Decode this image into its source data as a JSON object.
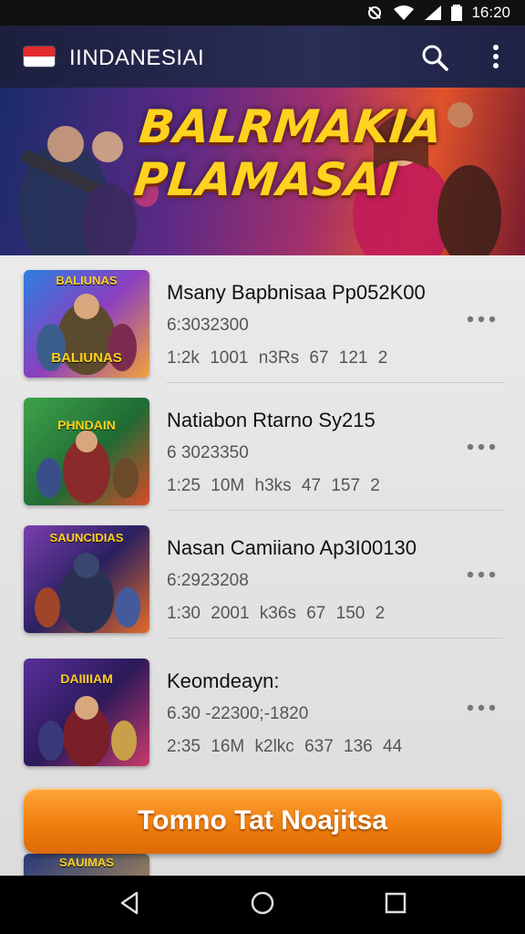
{
  "status_bar": {
    "time": "16:20",
    "icons": [
      "wifi-icon",
      "signal-icon",
      "battery-icon"
    ]
  },
  "app_bar": {
    "title": "IINDANESIAI",
    "flag_colors": [
      "#e32b2b",
      "#ffffff"
    ],
    "actions": [
      "search-icon",
      "more-vertical-icon"
    ]
  },
  "banner": {
    "title_line1": "BALRMAKIA",
    "title_line2": "PLAMASAI"
  },
  "games": [
    {
      "title": "Msany Bapbnisaa Pp052K00",
      "subtitle": "6:3032300",
      "stats": "1:2k 1001 n3Rs 67 121 2",
      "thumb_label": "BALIUNAS",
      "thumb_colors": [
        "#2c7fe0",
        "#f2a23a"
      ]
    },
    {
      "title": "Natiabon Rtarno Sy215",
      "subtitle": "6 3023350",
      "stats": "1:25 10M h3ks 47 157 2",
      "thumb_label": "PHNDAIN",
      "thumb_colors": [
        "#3fa34a",
        "#d94b2a"
      ]
    },
    {
      "title": "Nasan Camiiano Ap3I00130",
      "subtitle": "6:2923208",
      "stats": "1:30 2001 k36s 67 150 2",
      "thumb_label": "SAUNCIDIAS",
      "thumb_colors": [
        "#7a3fb0",
        "#e36b2a"
      ]
    },
    {
      "title": "Keomdeayn:",
      "subtitle": "6.30 -22300;-1820",
      "stats": "2:35 16M k2lkc 637 136 44",
      "thumb_label": "DAIIIIAM",
      "thumb_colors": [
        "#5a2f9c",
        "#c93a6b"
      ]
    }
  ],
  "partial_item": {
    "thumb_label": "SAUIMAS"
  },
  "cta": {
    "label": "Tomno Tat Noajitsa",
    "color": "#f07f0e"
  },
  "nav_bar": {
    "buttons": [
      "back-icon",
      "home-icon",
      "recents-icon"
    ]
  }
}
